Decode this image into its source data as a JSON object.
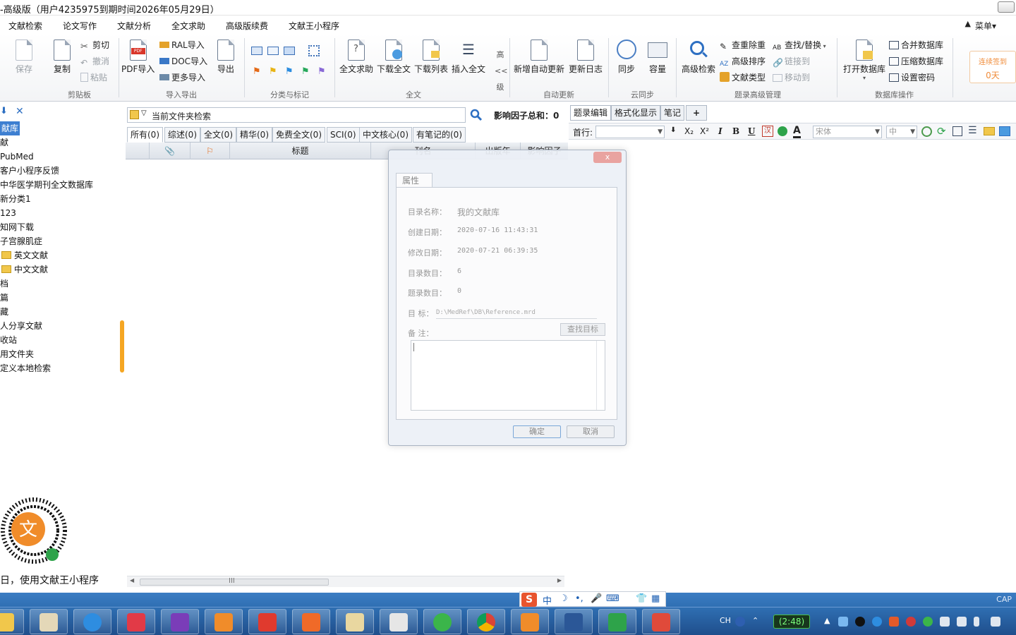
{
  "window": {
    "title": "-高级版（用户4235975到期时间2026年05月29日）"
  },
  "menu": {
    "items": [
      "文献检索",
      "论文写作",
      "文献分析",
      "全文求助",
      "高级版续费",
      "文献王小程序"
    ],
    "right_label": "菜单"
  },
  "ribbon": {
    "clipboard": {
      "save": "保存",
      "copy": "复制",
      "cut": "剪切",
      "undo": "撤消",
      "paste": "粘贴",
      "group": "剪贴板"
    },
    "import_export": {
      "pdf_import": "PDF导入",
      "ral_import": "RAL导入",
      "doc_import": "DOC导入",
      "more_import": "更多导入",
      "export": "导出",
      "group": "导入导出"
    },
    "classify": {
      "group": "分类与标记"
    },
    "fulltext": {
      "help": "全文求助",
      "download": "下载全文",
      "download_list": "下载列表",
      "insert": "插入全文",
      "advanced_1": "高",
      "advanced_2": "<<",
      "advanced_3": "级",
      "group": "全文"
    },
    "auto_update": {
      "new": "新增自动更新",
      "log": "更新日志",
      "group": "自动更新"
    },
    "cloud": {
      "sync": "同步",
      "capacity": "容量",
      "group": "云同步"
    },
    "advanced": {
      "search": "高级检索",
      "dedupe": "查重除重",
      "sort": "高级排序",
      "doc_type": "文献类型",
      "find_replace": "查找/替换",
      "link_to": "链接到",
      "move_to": "移动到",
      "group": "题录高级管理"
    },
    "database": {
      "open": "打开数据库",
      "merge": "合并数据库",
      "compress": "压缩数据库",
      "password": "设置密码",
      "group": "数据库操作"
    },
    "signin": {
      "label": "连续签到",
      "days": "0天"
    }
  },
  "sidebar": {
    "items": [
      {
        "label": "献库",
        "selected": true
      },
      {
        "label": "献",
        "selected": false
      },
      {
        "label": "PubMed",
        "selected": false
      },
      {
        "label": "客户小程序反馈",
        "selected": false
      },
      {
        "label": "中华医学期刊全文数据库",
        "selected": false
      },
      {
        "label": "新分类1",
        "selected": false
      },
      {
        "label": "123",
        "selected": false
      },
      {
        "label": "知网下载",
        "selected": false
      },
      {
        "label": "子宫腺肌症",
        "selected": false
      },
      {
        "label": "英文文献",
        "selected": false
      },
      {
        "label": "中文文献",
        "selected": false
      },
      {
        "label": "档",
        "selected": false
      },
      {
        "label": "篇",
        "selected": false
      },
      {
        "label": "藏",
        "selected": false
      },
      {
        "label": "人分享文献",
        "selected": false
      },
      {
        "label": "收站",
        "selected": false
      },
      {
        "label": "用文件夹",
        "selected": false
      },
      {
        "label": "定义本地检索",
        "selected": false
      }
    ],
    "caption": "日，使用文献王小程序"
  },
  "center": {
    "search_text": "当前文件夹检索",
    "impact_label": "影响因子总和：",
    "impact_value": "0",
    "tabs": [
      "所有(0)",
      "综述(0)",
      "全文(0)",
      "精华(0)",
      "免费全文(0)",
      "SCI(0)",
      "中文核心(0)",
      "有笔记的(0)"
    ],
    "columns": [
      "标题",
      "刊名",
      "出版年",
      "影响因子"
    ],
    "scroll_grip": "III"
  },
  "right_panel": {
    "tabs": [
      "题录编辑",
      "格式化显示",
      "笔记"
    ],
    "add_tab": "+",
    "first_line_label": "首行:",
    "font_name": "宋体",
    "font_size": "中",
    "fmt": [
      "B",
      "I",
      "U"
    ]
  },
  "dialog": {
    "close": "x",
    "tab": "属性",
    "fields": [
      {
        "label": "目录名称：",
        "value": "我的文献库"
      },
      {
        "label": "创建日期：",
        "value": "2020-07-16 11:43:31"
      },
      {
        "label": "修改日期：",
        "value": "2020-07-21 06:39:35"
      },
      {
        "label": "目录数目：",
        "value": "6"
      },
      {
        "label": "题录数目：",
        "value": "0"
      }
    ],
    "target_label": "目  标：",
    "target_value": "D:\\MedRef\\DB\\Reference.mrd",
    "find_target": "查找目标",
    "note_label": "备  注：",
    "ok": "确定",
    "cancel": "取消"
  },
  "ime": {
    "items": [
      "中",
      "☽",
      "•,",
      "🎤",
      "⌨",
      "👕",
      "▦"
    ]
  },
  "taskbar": {
    "cap": "CAP",
    "lang": "CH",
    "time": "(2:48)"
  },
  "colors": {
    "selection": "#3d7fd1",
    "accent_orange": "#f5a623",
    "taskbar": "#2f6fb3"
  }
}
